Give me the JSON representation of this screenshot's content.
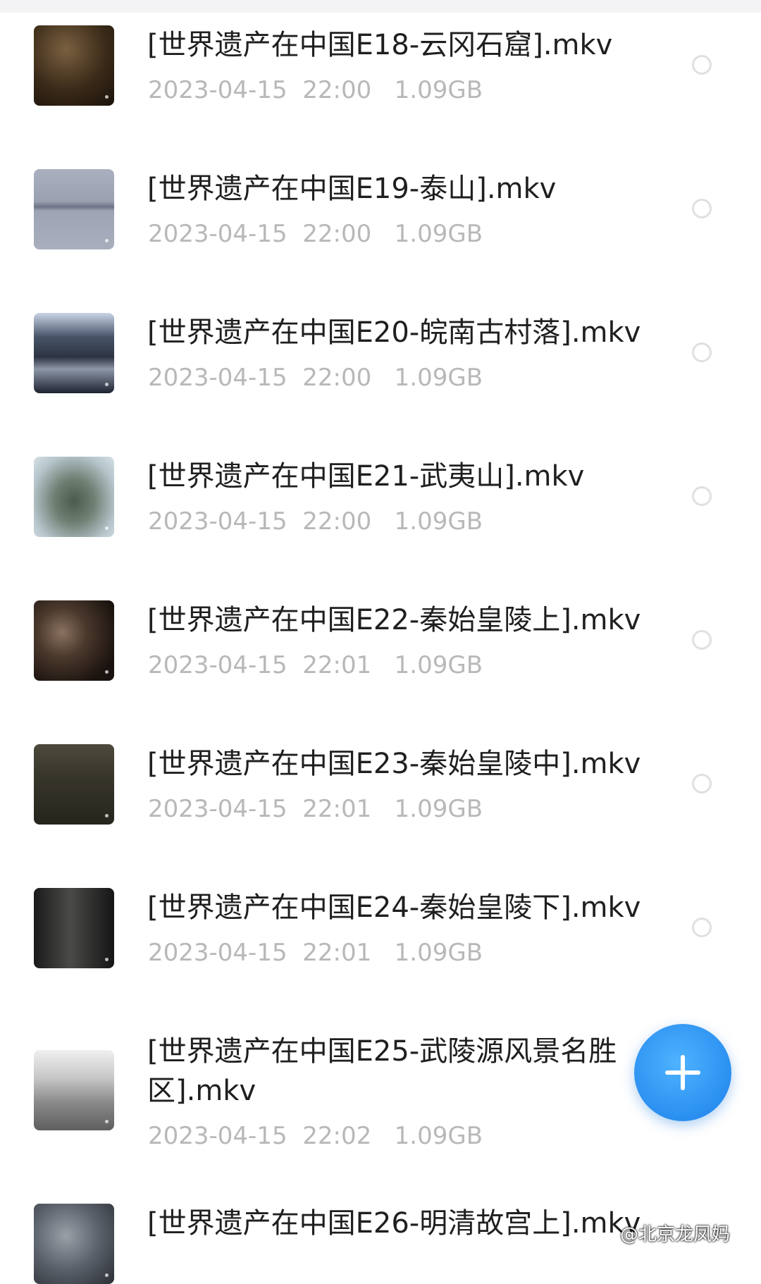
{
  "files": [
    {
      "name": "[世界遗产在中国E18-云冈石窟].mkv",
      "date": "2023-04-15",
      "time": "22:00",
      "size": "1.09GB",
      "thumbnail": "thumbnail-image"
    },
    {
      "name": "[世界遗产在中国E19-泰山].mkv",
      "date": "2023-04-15",
      "time": "22:00",
      "size": "1.09GB",
      "thumbnail": "thumbnail-image"
    },
    {
      "name": "[世界遗产在中国E20-皖南古村落].mkv",
      "date": "2023-04-15",
      "time": "22:00",
      "size": "1.09GB",
      "thumbnail": "thumbnail-image"
    },
    {
      "name": "[世界遗产在中国E21-武夷山].mkv",
      "date": "2023-04-15",
      "time": "22:00",
      "size": "1.09GB",
      "thumbnail": "thumbnail-image"
    },
    {
      "name": "[世界遗产在中国E22-秦始皇陵上].mkv",
      "date": "2023-04-15",
      "time": "22:01",
      "size": "1.09GB",
      "thumbnail": "thumbnail-image"
    },
    {
      "name": "[世界遗产在中国E23-秦始皇陵中].mkv",
      "date": "2023-04-15",
      "time": "22:01",
      "size": "1.09GB",
      "thumbnail": "thumbnail-image"
    },
    {
      "name": "[世界遗产在中国E24-秦始皇陵下].mkv",
      "date": "2023-04-15",
      "time": "22:01",
      "size": "1.09GB",
      "thumbnail": "thumbnail-image"
    },
    {
      "name": "[世界遗产在中国E25-武陵源风景名胜区].mkv",
      "date": "2023-04-15",
      "time": "22:02",
      "size": "1.09GB",
      "thumbnail": "thumbnail-image"
    },
    {
      "name": "[世界遗产在中国E26-明清故宫上].mkv",
      "date": "",
      "time": "",
      "size": "",
      "thumbnail": "thumbnail-image"
    }
  ],
  "fab": {
    "icon": "plus-icon",
    "color": "#2a8ff0"
  },
  "watermark": "@北京龙凤妈",
  "colors": {
    "title": "#1f1f1f",
    "meta": "#b8b8b8",
    "radio": "#e0e0e0",
    "accent": "#2a8ff0"
  }
}
